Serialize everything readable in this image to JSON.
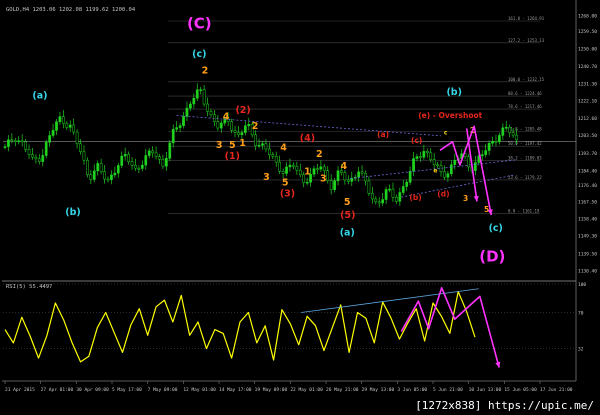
{
  "window": {
    "title": "GOLD,H4 1203.06 1202.08 1199.62 1200.04",
    "rsi_title": "RSI(5) 55.4497",
    "watermark": "[1272x838] https://upic.me/"
  },
  "colors": {
    "background": "#000000",
    "candle": "#1fd31f",
    "rsi": "#ffff00",
    "projection": "#ff33ff",
    "cyan_label": "#33d6e6",
    "red_label": "#e5261c",
    "orange_label": "#ff9f1a",
    "yellow_label": "#ffd21a",
    "fib_line": "#444444",
    "trend_line": "#6a6ad8"
  },
  "chart_data": [
    {
      "type": "candlestick",
      "symbol": "GOLD",
      "timeframe": "H4",
      "ohlc": {
        "open": 1203.06,
        "high": 1202.08,
        "low": 1199.62,
        "close": 1200.04
      },
      "current_price": 1200.04,
      "y_ticks": [
        1268.0,
        1259.5,
        1250.0,
        1240.7,
        1231.3,
        1222.1,
        1212.6,
        1203.5,
        1193.7,
        1184.4,
        1176.4,
        1167.5,
        1158.4,
        1149.3,
        1139.5,
        1130.4
      ],
      "ylim": [
        1128,
        1273
      ],
      "x_ticks": [
        "21 Apr 2015",
        "27 Apr 01:00",
        "30 Apr 09:00",
        "5 May 17:00",
        "7 May 09:00",
        "12 May 01:00",
        "14 May 17:00",
        "19 May 09:00",
        "22 May 01:00",
        "26 May 21:00",
        "29 May 13:00",
        "3 Jun 05:00",
        "5 Jun 21:00",
        "10 Jun 13:00",
        "15 Jun 05:00",
        "17 Jun 21:00"
      ],
      "price_path": [
        1196,
        1203,
        1198,
        1189,
        1193,
        1205,
        1213,
        1208,
        1196,
        1181,
        1186,
        1178,
        1187,
        1192,
        1185,
        1190,
        1195,
        1187,
        1203,
        1212,
        1222,
        1227,
        1215,
        1207,
        1212,
        1202,
        1209,
        1200,
        1196,
        1189,
        1184,
        1187,
        1179,
        1182,
        1187,
        1176,
        1183,
        1178,
        1185,
        1174,
        1166,
        1173,
        1169,
        1177,
        1189,
        1196,
        1189,
        1181,
        1187,
        1193,
        1186,
        1191,
        1197,
        1204,
        1207,
        1200
      ],
      "fibonacci_levels": [
        {
          "label": "161.8 - 1264.91",
          "value": 1264.91
        },
        {
          "label": "127.2 - 1253.13",
          "value": 1253.13
        },
        {
          "label": "100.0 - 1232.15",
          "value": 1232.15
        },
        {
          "label": "88.6 - 1224.46",
          "value": 1224.46
        },
        {
          "label": "78.6 - 1217.46",
          "value": 1217.46
        },
        {
          "label": "61.8 - 1205.48",
          "value": 1205.48
        },
        {
          "label": "50.0 - 1197.42",
          "value": 1197.42
        },
        {
          "label": "38.2 - 1189.83",
          "value": 1189.83
        },
        {
          "label": "23.6 - 1179.22",
          "value": 1179.22
        },
        {
          "label": "0.0 - 1161.19",
          "value": 1161.19
        }
      ],
      "wave_labels": [
        {
          "text": "(C)",
          "color": "magenta",
          "size": "big",
          "t": 0.345,
          "p": 1260.8
        },
        {
          "text": "(c)",
          "color": "cyan",
          "size": "mid",
          "t": 0.345,
          "p": 1245.6
        },
        {
          "text": "(a)",
          "color": "cyan",
          "size": "mid",
          "t": 0.065,
          "p": 1223.1
        },
        {
          "text": "(b)",
          "color": "cyan",
          "size": "mid",
          "t": 0.123,
          "p": 1160.3
        },
        {
          "text": "(a)",
          "color": "cyan",
          "size": "mid",
          "t": 0.605,
          "p": 1149.3
        },
        {
          "text": "(b)",
          "color": "cyan",
          "size": "mid",
          "t": 0.793,
          "p": 1225.0
        },
        {
          "text": "(c)",
          "color": "cyan",
          "size": "mid",
          "t": 0.866,
          "p": 1151.6
        },
        {
          "text": "(D)",
          "color": "magenta",
          "size": "big",
          "t": 0.86,
          "p": 1135.4
        },
        {
          "text": "(e) - Overshoot",
          "color": "red",
          "size": "small",
          "t": 0.786,
          "p": 1212.6
        },
        {
          "text": "(2)",
          "color": "red",
          "size": "mid",
          "t": 0.422,
          "p": 1215.2
        },
        {
          "text": "(1)",
          "color": "red",
          "size": "mid",
          "t": 0.403,
          "p": 1190.5
        },
        {
          "text": "(3)",
          "color": "red",
          "size": "mid",
          "t": 0.5,
          "p": 1170.4
        },
        {
          "text": "(4)",
          "color": "red",
          "size": "mid",
          "t": 0.535,
          "p": 1200.3
        },
        {
          "text": "(5)",
          "color": "red",
          "size": "mid",
          "t": 0.606,
          "p": 1158.6
        },
        {
          "text": "(a)",
          "color": "red",
          "size": "small",
          "t": 0.668,
          "p": 1202.3
        },
        {
          "text": "(c)",
          "color": "red",
          "size": "small",
          "t": 0.727,
          "p": 1199.2
        },
        {
          "text": "(b)",
          "color": "red",
          "size": "small",
          "t": 0.725,
          "p": 1168.4
        },
        {
          "text": "(d)",
          "color": "red",
          "size": "small",
          "t": 0.774,
          "p": 1170.4
        },
        {
          "text": "2",
          "color": "orange",
          "size": "mid",
          "t": 0.355,
          "p": 1236.5
        },
        {
          "text": "4",
          "color": "orange",
          "size": "mid",
          "t": 0.392,
          "p": 1211.9
        },
        {
          "text": "3",
          "color": "orange",
          "size": "mid",
          "t": 0.38,
          "p": 1196.4
        },
        {
          "text": "5",
          "color": "orange",
          "size": "mid",
          "t": 0.403,
          "p": 1196.4
        },
        {
          "text": "1",
          "color": "orange",
          "size": "mid",
          "t": 0.421,
          "p": 1197.6
        },
        {
          "text": "2",
          "color": "orange",
          "size": "mid",
          "t": 0.443,
          "p": 1206.6
        },
        {
          "text": "4",
          "color": "orange",
          "size": "mid",
          "t": 0.493,
          "p": 1195.0
        },
        {
          "text": "3",
          "color": "orange",
          "size": "mid",
          "t": 0.463,
          "p": 1179.2
        },
        {
          "text": "5",
          "color": "orange",
          "size": "mid",
          "t": 0.496,
          "p": 1176.2
        },
        {
          "text": "1",
          "color": "orange",
          "size": "mid",
          "t": 0.535,
          "p": 1182.3
        },
        {
          "text": "2",
          "color": "orange",
          "size": "mid",
          "t": 0.556,
          "p": 1191.6
        },
        {
          "text": "3",
          "color": "orange",
          "size": "mid",
          "t": 0.563,
          "p": 1178.4
        },
        {
          "text": "4",
          "color": "orange",
          "size": "mid",
          "t": 0.599,
          "p": 1185.2
        },
        {
          "text": "5",
          "color": "orange",
          "size": "mid",
          "t": 0.605,
          "p": 1165.8
        },
        {
          "text": "2",
          "color": "orange",
          "size": "small",
          "t": 0.825,
          "p": 1204.5
        },
        {
          "text": "3",
          "color": "orange",
          "size": "small",
          "t": 0.813,
          "p": 1167.8
        },
        {
          "text": "5",
          "color": "orange",
          "size": "small",
          "t": 0.85,
          "p": 1161.9
        },
        {
          "text": "c",
          "color": "yellow",
          "size": "tiny",
          "t": 0.778,
          "p": 1203.6
        },
        {
          "text": "e",
          "color": "yellow",
          "size": "tiny",
          "t": 0.76,
          "p": 1183.2
        }
      ],
      "projection_path": [
        [
          0.768,
          1195.2
        ],
        [
          0.79,
          1199.8
        ],
        [
          0.803,
          1187.3
        ],
        [
          0.828,
          1208.2
        ],
        [
          0.858,
          1160.3
        ]
      ],
      "projection_arrow": [
        [
          0.815,
          1207.0
        ],
        [
          0.833,
          1167.6
        ]
      ]
    },
    {
      "type": "line",
      "title": "RSI(5) 55.4497",
      "series": [
        {
          "name": "RSI(5)",
          "values": [
            52,
            38,
            65,
            45,
            22,
            46,
            80,
            62,
            38,
            18,
            24,
            54,
            70,
            49,
            28,
            57,
            74,
            46,
            76,
            83,
            60,
            88,
            46,
            60,
            32,
            52,
            48,
            22,
            60,
            70,
            38,
            56,
            20,
            73,
            58,
            36,
            66,
            56,
            30,
            54,
            78,
            28,
            70,
            64,
            38,
            81,
            64,
            42,
            59,
            74,
            40,
            80,
            66,
            48,
            92,
            71,
            44
          ]
        }
      ],
      "y_ticks": [
        100,
        70,
        32
      ],
      "ylim": [
        0,
        100
      ],
      "divergence_line": [
        [
          0.524,
          70
        ],
        [
          0.836,
          95
        ]
      ],
      "projection_path": [
        [
          0.7,
          50
        ],
        [
          0.73,
          82
        ],
        [
          0.748,
          53
        ],
        [
          0.771,
          96
        ],
        [
          0.794,
          63
        ],
        [
          0.838,
          87
        ],
        [
          0.872,
          12
        ]
      ]
    }
  ]
}
